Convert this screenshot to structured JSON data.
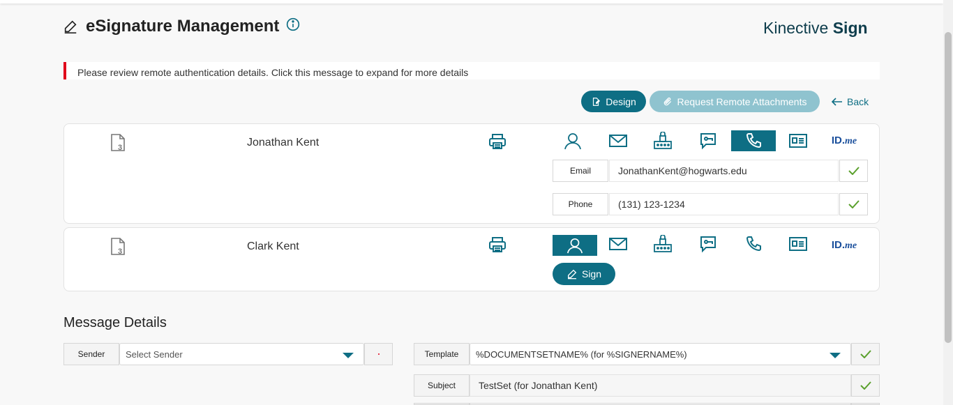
{
  "header": {
    "title": "eSignature Management",
    "brand_light": "Kinective",
    "brand_bold": "Sign"
  },
  "alert": {
    "text": "Please review remote authentication details. Click this message to expand for more details"
  },
  "toolbar": {
    "design_label": "Design",
    "remote_label": "Request Remote Attachments",
    "back_label": "Back"
  },
  "signers": [
    {
      "name": "Jonathan Kent",
      "doc_count": "3",
      "active_method": "phone",
      "fields": [
        {
          "label": "Email",
          "value": "JonathanKent@hogwarts.edu"
        },
        {
          "label": "Phone",
          "value": "(131) 123-1234"
        }
      ]
    },
    {
      "name": "Clark Kent",
      "doc_count": "3",
      "active_method": "in-person",
      "sign_label": "Sign"
    }
  ],
  "auth_methods": [
    "person-icon",
    "email-icon",
    "router-icon",
    "chat-icon",
    "phone-icon",
    "id-card-icon",
    "idme-logo"
  ],
  "idme": {
    "id": "ID.",
    "me": "me"
  },
  "message_details": {
    "title": "Message Details",
    "sender_label": "Sender",
    "sender_placeholder": "Select Sender",
    "template_label": "Template",
    "template_value": "%DOCUMENTSETNAME% (for %SIGNERNAME%)",
    "subject_label": "Subject",
    "subject_value": "TestSet (for Jonathan Kent)"
  },
  "colors": {
    "primary": "#0e6e84",
    "primary_disabled": "#8fc3cf",
    "alert_border": "#e0001b",
    "check": "#5aa02c",
    "brand": "#0e3d4c"
  }
}
